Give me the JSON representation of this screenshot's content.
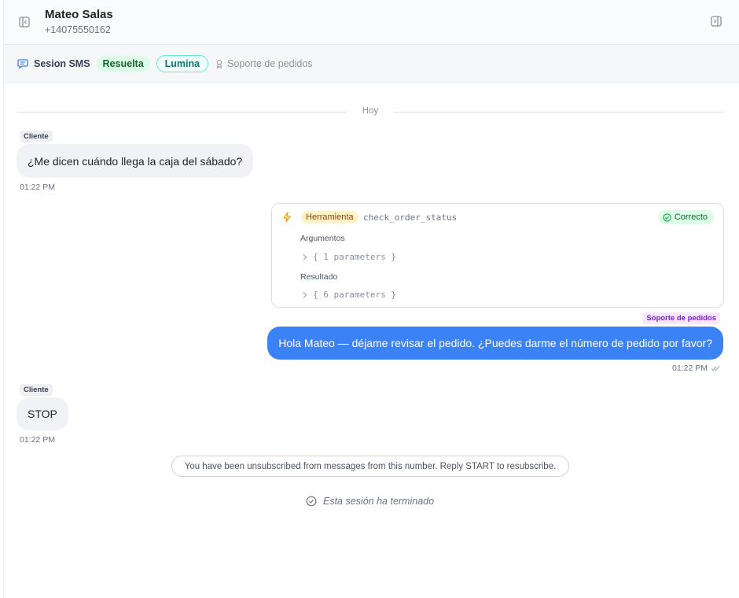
{
  "header": {
    "contact_name": "Mateo Salas",
    "contact_phone": "+14075550162",
    "left_icon": "sidebar-toggle-left-icon",
    "right_icon": "sidebar-toggle-right-icon"
  },
  "session": {
    "label": "Sesion SMS",
    "status": "Resuelta",
    "agent": "Lumina",
    "team": "Soporte de pedidos"
  },
  "divider_label": "Hoy",
  "messages": [
    {
      "sender_tag": "Cliente",
      "text": "¿Me dicen cuándo llega la caja del sábado?",
      "time": "01:22 PM"
    },
    {
      "sender_tag": "Soporte de pedidos",
      "text": "Hola Mateo — déjame revisar el pedido. ¿Puedes darme el número de pedido por favor?",
      "time": "01:22 PM"
    },
    {
      "sender_tag": "Cliente",
      "text": "STOP",
      "time": "01:22 PM"
    }
  ],
  "tool_call": {
    "badge": "Herramienta",
    "name": "check_order_status",
    "status": "Correcto",
    "args_label": "Argumentos",
    "args_summary": "{ 1 parameters }",
    "result_label": "Resultado",
    "result_summary": "{ 6 parameters }"
  },
  "system_notice": "You have been unsubscribed from messages from this number. Reply START to resubscribe.",
  "ended_text": "Esta sesión ha terminado",
  "colors": {
    "outgoing_bubble": "#3b82f6",
    "status_green": "#dcfce7",
    "tool_badge": "#fef3c7",
    "agent_tag": "#f3e8ff"
  }
}
